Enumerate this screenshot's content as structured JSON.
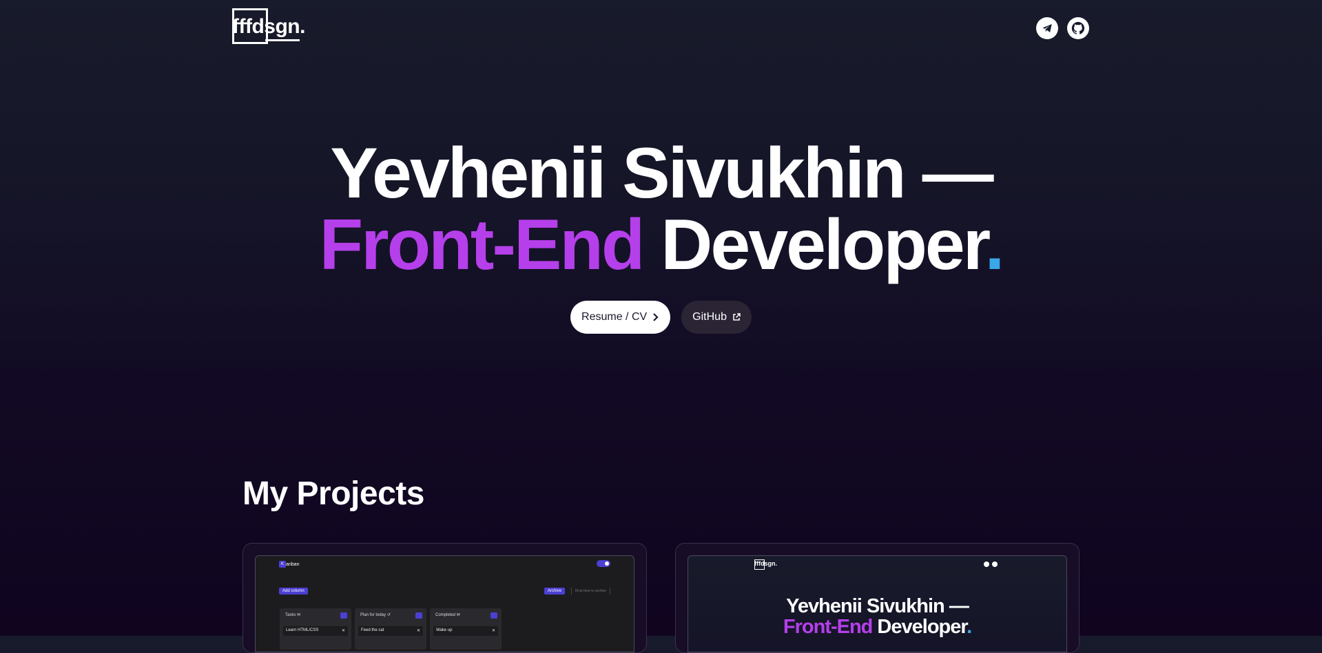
{
  "header": {
    "logo_text": "fffdsgn.",
    "social": [
      {
        "icon": "telegram-icon"
      },
      {
        "icon": "github-icon"
      }
    ]
  },
  "hero": {
    "line1": "Yevhenii Sivukhin —",
    "accent": "Front-End",
    "rest": " Developer",
    "dot": ".",
    "colors": {
      "accent": "#b53fea",
      "dot": "#3aa7e8"
    }
  },
  "buttons": {
    "resume_label": "Resume / CV",
    "github_label": "GitHub"
  },
  "projects": {
    "title": "My Projects",
    "kanban_preview": {
      "brand": "anban",
      "brand_letter": "K",
      "add_column": "Add column",
      "archive": "Archive",
      "drop_text": "Drop here to archive",
      "columns": [
        {
          "title": "Tasks ✉",
          "task": "Learn HTML/CSS"
        },
        {
          "title": "Plan for today ↺",
          "task": "Feed the cat"
        },
        {
          "title": "Completed ✉",
          "task": "Wake up"
        }
      ]
    },
    "portfolio_preview": {
      "logo": "fffdsgn.",
      "line1": "Yevhenii Sivukhin —",
      "accent": "Front-End",
      "rest": " Developer",
      "dot": "."
    }
  }
}
